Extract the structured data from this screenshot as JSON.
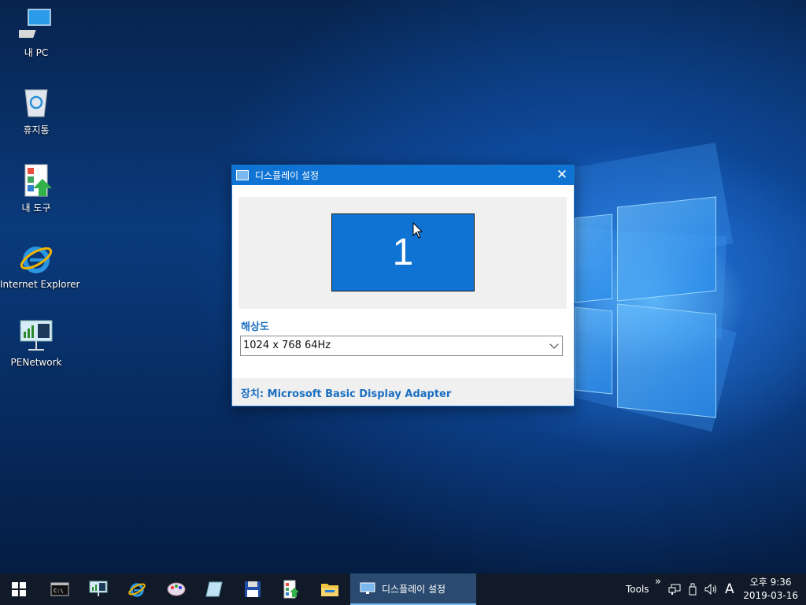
{
  "desktop": {
    "icons": [
      {
        "label": "내 PC",
        "icon": "computer-icon"
      },
      {
        "label": "휴지통",
        "icon": "recycle-bin-icon"
      },
      {
        "label": "내 도구",
        "icon": "tools-icon"
      },
      {
        "label": "Internet Explorer",
        "icon": "internet-explorer-icon"
      },
      {
        "label": "PENetwork",
        "icon": "network-icon"
      }
    ]
  },
  "dialog": {
    "title": "디스플레이 설정",
    "close_label": "✕",
    "monitor_number": "1",
    "resolution_label": "해상도",
    "resolution_value": "1024 x 768 64Hz",
    "device_text": "장치: Microsoft Basic Display Adapter"
  },
  "taskbar": {
    "pinned": [
      "start-icon",
      "command-prompt-icon",
      "pe-network-icon",
      "internet-explorer-icon",
      "paint-icon",
      "notepad-icon",
      "save-disk-icon",
      "tools-icon",
      "file-explorer-icon"
    ],
    "active_task_label": "디스플레이 설정",
    "tools_label": "Tools",
    "overflow_label": "»",
    "ime_label": "A",
    "clock_time": "오후 9:36",
    "clock_date": "2019-03-16"
  },
  "colors": {
    "accent": "#0e73d3",
    "taskbar": "#101a28",
    "label_blue": "#1a6fc0"
  }
}
